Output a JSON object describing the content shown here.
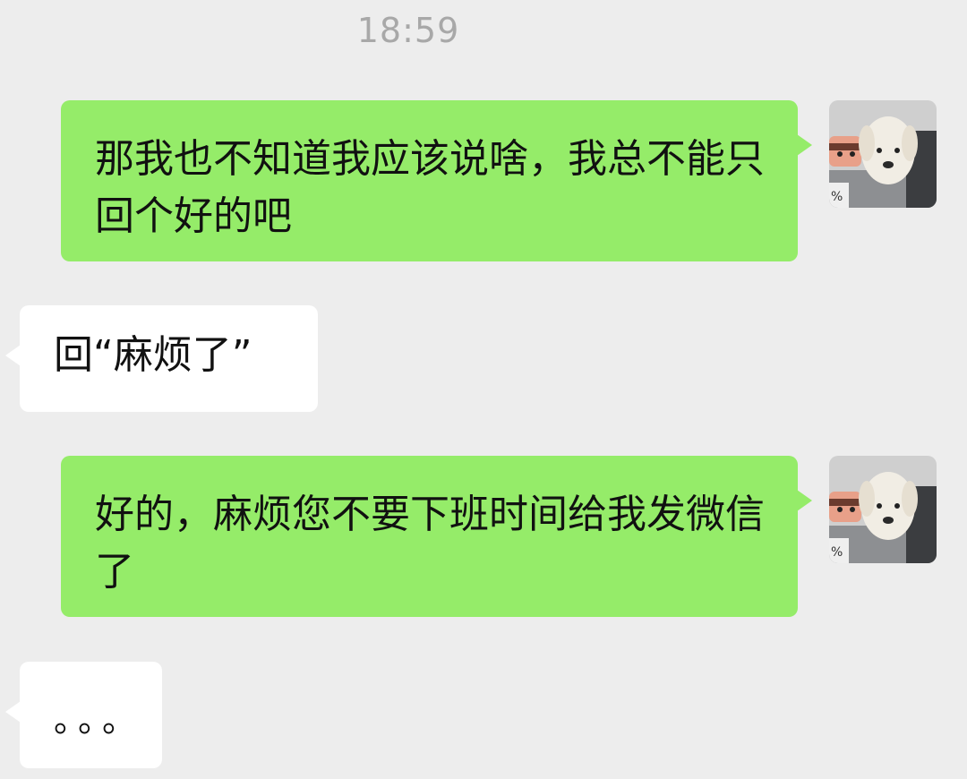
{
  "timestamp": "18:59",
  "messages": [
    {
      "direction": "out",
      "text": "那我也不知道我应该说啥，我总不能只回个好的吧",
      "avatar": "dog-avatar-icon"
    },
    {
      "direction": "in",
      "text": "回“麻烦了”"
    },
    {
      "direction": "out",
      "text": "好的，麻烦您不要下班时间给我发微信了",
      "avatar": "dog-avatar-icon"
    },
    {
      "direction": "in",
      "text": "。。。"
    }
  ],
  "colors": {
    "background": "#ededed",
    "outgoing_bubble": "#95ec69",
    "incoming_bubble": "#ffffff",
    "timestamp_text": "#a8a8a8"
  }
}
